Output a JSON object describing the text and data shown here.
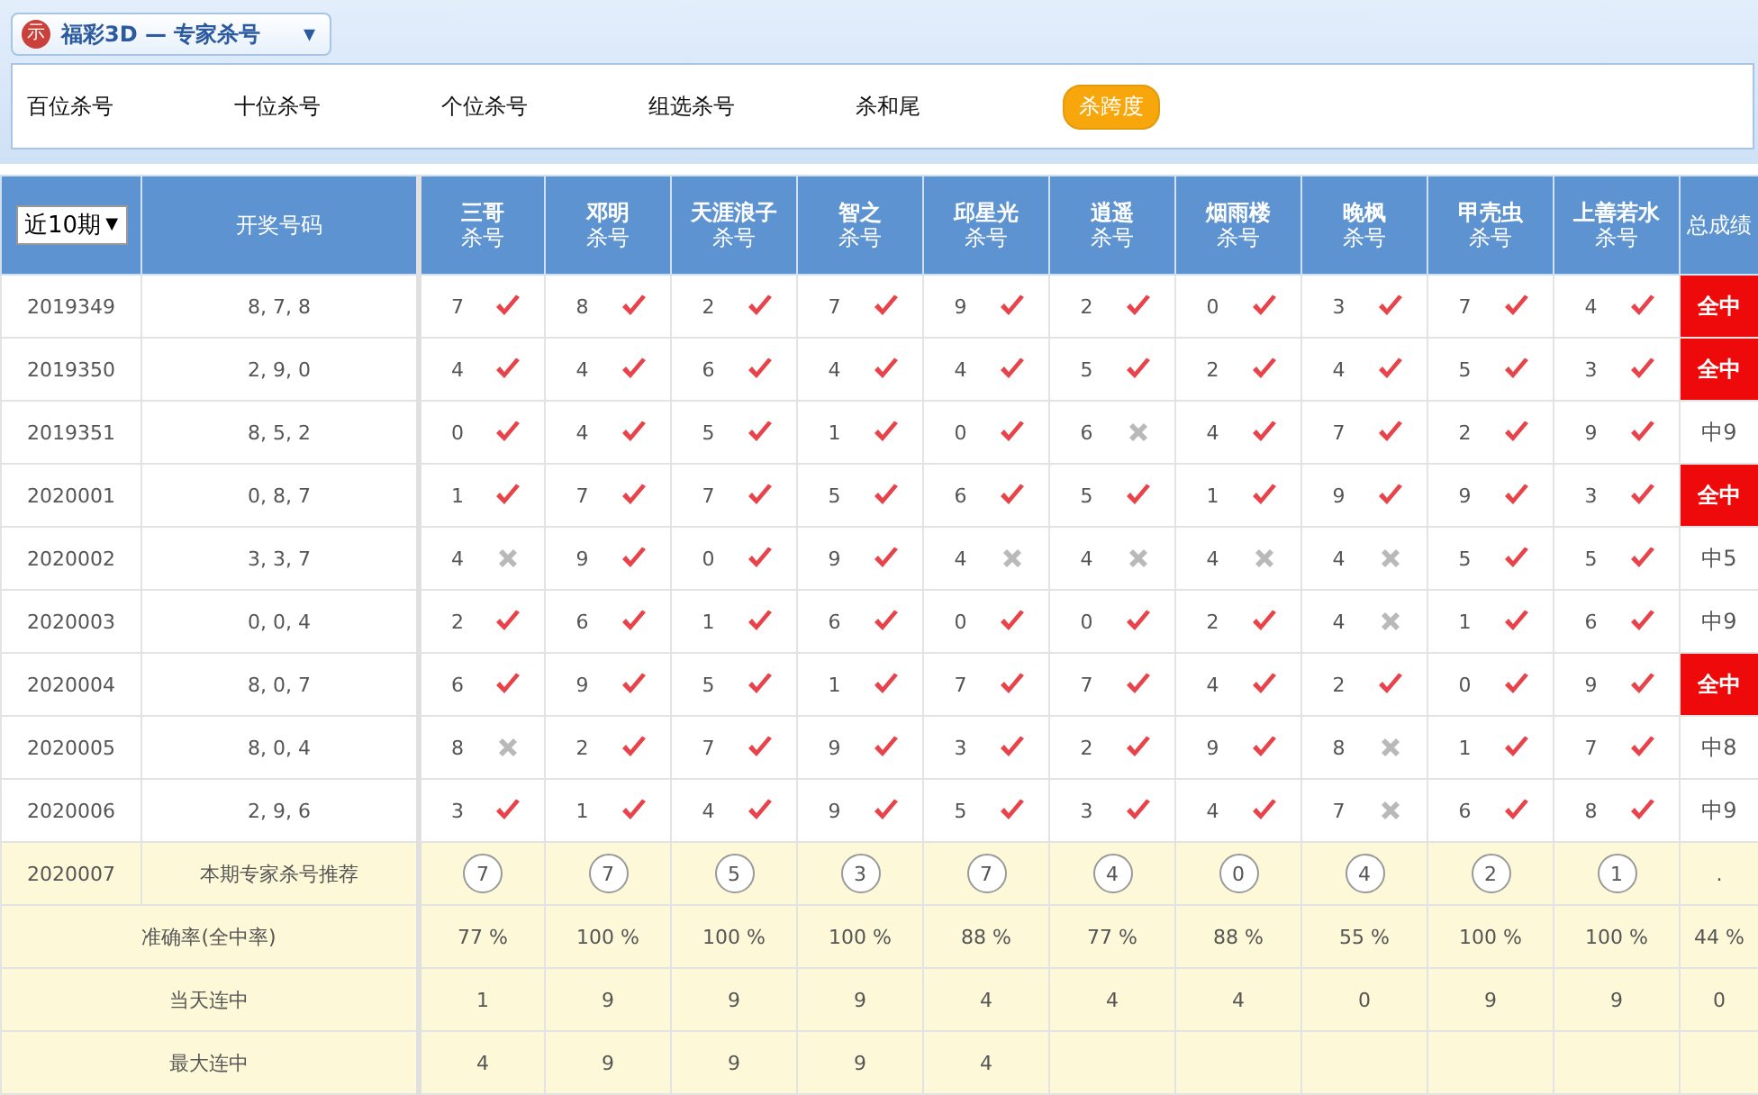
{
  "header": {
    "logo": "示",
    "title": "福彩3D — 专家杀号",
    "caret": "▾"
  },
  "tabs": [
    {
      "label": "百位杀号",
      "selected": false
    },
    {
      "label": "十位杀号",
      "selected": false
    },
    {
      "label": "个位杀号",
      "selected": false
    },
    {
      "label": "组选杀号",
      "selected": false
    },
    {
      "label": "杀和尾",
      "selected": false
    },
    {
      "label": "杀跨度",
      "selected": true
    }
  ],
  "table": {
    "period_select": {
      "value": "近10期",
      "caret": "▼"
    },
    "numbers_heading": "开奖号码",
    "total_heading": "总成绩",
    "experts": [
      {
        "name": "三哥",
        "sub": "杀号"
      },
      {
        "name": "邓明",
        "sub": "杀号"
      },
      {
        "name": "天涯浪子",
        "sub": "杀号"
      },
      {
        "name": "智之",
        "sub": "杀号"
      },
      {
        "name": "邱星光",
        "sub": "杀号"
      },
      {
        "name": "逍遥",
        "sub": "杀号"
      },
      {
        "name": "烟雨楼",
        "sub": "杀号"
      },
      {
        "name": "晚枫",
        "sub": "杀号"
      },
      {
        "name": "甲壳虫",
        "sub": "杀号"
      },
      {
        "name": "上善若水",
        "sub": "杀号"
      }
    ],
    "rows": [
      {
        "period": "2019349",
        "numbers": "8, 7, 8",
        "kills": [
          {
            "num": "7",
            "hit": true
          },
          {
            "num": "8",
            "hit": true
          },
          {
            "num": "2",
            "hit": true
          },
          {
            "num": "7",
            "hit": true
          },
          {
            "num": "9",
            "hit": true
          },
          {
            "num": "2",
            "hit": true
          },
          {
            "num": "0",
            "hit": true
          },
          {
            "num": "3",
            "hit": true
          },
          {
            "num": "7",
            "hit": true
          },
          {
            "num": "4",
            "hit": true
          }
        ],
        "total": {
          "text": "全中",
          "full": true
        }
      },
      {
        "period": "2019350",
        "numbers": "2, 9, 0",
        "kills": [
          {
            "num": "4",
            "hit": true
          },
          {
            "num": "4",
            "hit": true
          },
          {
            "num": "6",
            "hit": true
          },
          {
            "num": "4",
            "hit": true
          },
          {
            "num": "4",
            "hit": true
          },
          {
            "num": "5",
            "hit": true
          },
          {
            "num": "2",
            "hit": true
          },
          {
            "num": "4",
            "hit": true
          },
          {
            "num": "5",
            "hit": true
          },
          {
            "num": "3",
            "hit": true
          }
        ],
        "total": {
          "text": "全中",
          "full": true
        }
      },
      {
        "period": "2019351",
        "numbers": "8, 5, 2",
        "kills": [
          {
            "num": "0",
            "hit": true
          },
          {
            "num": "4",
            "hit": true
          },
          {
            "num": "5",
            "hit": true
          },
          {
            "num": "1",
            "hit": true
          },
          {
            "num": "0",
            "hit": true
          },
          {
            "num": "6",
            "hit": false
          },
          {
            "num": "4",
            "hit": true
          },
          {
            "num": "7",
            "hit": true
          },
          {
            "num": "2",
            "hit": true
          },
          {
            "num": "9",
            "hit": true
          }
        ],
        "total": {
          "text": "中9",
          "full": false
        }
      },
      {
        "period": "2020001",
        "numbers": "0, 8, 7",
        "kills": [
          {
            "num": "1",
            "hit": true
          },
          {
            "num": "7",
            "hit": true
          },
          {
            "num": "7",
            "hit": true
          },
          {
            "num": "5",
            "hit": true
          },
          {
            "num": "6",
            "hit": true
          },
          {
            "num": "5",
            "hit": true
          },
          {
            "num": "1",
            "hit": true
          },
          {
            "num": "9",
            "hit": true
          },
          {
            "num": "9",
            "hit": true
          },
          {
            "num": "3",
            "hit": true
          }
        ],
        "total": {
          "text": "全中",
          "full": true
        }
      },
      {
        "period": "2020002",
        "numbers": "3, 3, 7",
        "kills": [
          {
            "num": "4",
            "hit": false
          },
          {
            "num": "9",
            "hit": true
          },
          {
            "num": "0",
            "hit": true
          },
          {
            "num": "9",
            "hit": true
          },
          {
            "num": "4",
            "hit": false
          },
          {
            "num": "4",
            "hit": false
          },
          {
            "num": "4",
            "hit": false
          },
          {
            "num": "4",
            "hit": false
          },
          {
            "num": "5",
            "hit": true
          },
          {
            "num": "5",
            "hit": true
          }
        ],
        "total": {
          "text": "中5",
          "full": false
        }
      },
      {
        "period": "2020003",
        "numbers": "0, 0, 4",
        "kills": [
          {
            "num": "2",
            "hit": true
          },
          {
            "num": "6",
            "hit": true
          },
          {
            "num": "1",
            "hit": true
          },
          {
            "num": "6",
            "hit": true
          },
          {
            "num": "0",
            "hit": true
          },
          {
            "num": "0",
            "hit": true
          },
          {
            "num": "2",
            "hit": true
          },
          {
            "num": "4",
            "hit": false
          },
          {
            "num": "1",
            "hit": true
          },
          {
            "num": "6",
            "hit": true
          }
        ],
        "total": {
          "text": "中9",
          "full": false
        }
      },
      {
        "period": "2020004",
        "numbers": "8, 0, 7",
        "kills": [
          {
            "num": "6",
            "hit": true
          },
          {
            "num": "9",
            "hit": true
          },
          {
            "num": "5",
            "hit": true
          },
          {
            "num": "1",
            "hit": true
          },
          {
            "num": "7",
            "hit": true
          },
          {
            "num": "7",
            "hit": true
          },
          {
            "num": "4",
            "hit": true
          },
          {
            "num": "2",
            "hit": true
          },
          {
            "num": "0",
            "hit": true
          },
          {
            "num": "9",
            "hit": true
          }
        ],
        "total": {
          "text": "全中",
          "full": true
        }
      },
      {
        "period": "2020005",
        "numbers": "8, 0, 4",
        "kills": [
          {
            "num": "8",
            "hit": false
          },
          {
            "num": "2",
            "hit": true
          },
          {
            "num": "7",
            "hit": true
          },
          {
            "num": "9",
            "hit": true
          },
          {
            "num": "3",
            "hit": true
          },
          {
            "num": "2",
            "hit": true
          },
          {
            "num": "9",
            "hit": true
          },
          {
            "num": "8",
            "hit": false
          },
          {
            "num": "1",
            "hit": true
          },
          {
            "num": "7",
            "hit": true
          }
        ],
        "total": {
          "text": "中8",
          "full": false
        }
      },
      {
        "period": "2020006",
        "numbers": "2, 9, 6",
        "kills": [
          {
            "num": "3",
            "hit": true
          },
          {
            "num": "1",
            "hit": true
          },
          {
            "num": "4",
            "hit": true
          },
          {
            "num": "9",
            "hit": true
          },
          {
            "num": "5",
            "hit": true
          },
          {
            "num": "3",
            "hit": true
          },
          {
            "num": "4",
            "hit": true
          },
          {
            "num": "7",
            "hit": false
          },
          {
            "num": "6",
            "hit": true
          },
          {
            "num": "8",
            "hit": true
          }
        ],
        "total": {
          "text": "中9",
          "full": false
        }
      }
    ],
    "recommend": {
      "period": "2020007",
      "label": "本期专家杀号推荐",
      "picks": [
        "7",
        "7",
        "5",
        "3",
        "7",
        "4",
        "0",
        "4",
        "2",
        "1"
      ],
      "total": "."
    },
    "stats": [
      {
        "label": "准确率(全中率)",
        "values": [
          "77 %",
          "100 %",
          "100 %",
          "100 %",
          "88 %",
          "77 %",
          "88 %",
          "55 %",
          "100 %",
          "100 %",
          "44 %"
        ]
      },
      {
        "label": "当天连中",
        "values": [
          "1",
          "9",
          "9",
          "9",
          "4",
          "4",
          "4",
          "0",
          "9",
          "9",
          "0"
        ]
      },
      {
        "label": "最大连中",
        "values": [
          "4",
          "9",
          "9",
          "9",
          "4"
        ]
      }
    ]
  }
}
